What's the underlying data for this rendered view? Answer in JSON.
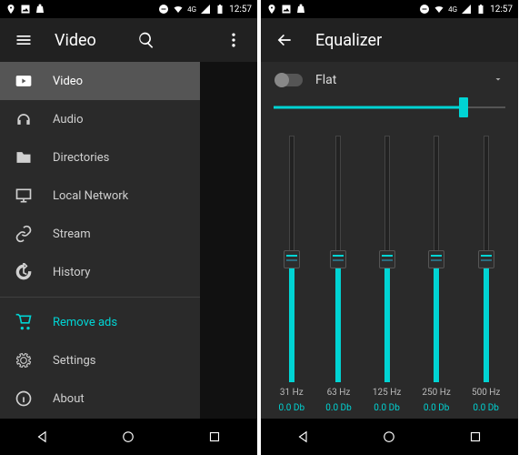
{
  "status": {
    "time": "12:57",
    "network": "4G"
  },
  "colors": {
    "accent": "#00d4d4"
  },
  "left": {
    "title": "Video",
    "drawer": {
      "items": [
        {
          "label": "Video",
          "icon": "play-rect-icon",
          "active": true
        },
        {
          "label": "Audio",
          "icon": "headphones-icon"
        },
        {
          "label": "Directories",
          "icon": "folder-icon"
        },
        {
          "label": "Local Network",
          "icon": "monitor-icon"
        },
        {
          "label": "Stream",
          "icon": "link-icon"
        },
        {
          "label": "History",
          "icon": "history-icon"
        }
      ],
      "items2": [
        {
          "label": "Remove ads",
          "icon": "cart-icon",
          "accent": true
        },
        {
          "label": "Settings",
          "icon": "gear-icon"
        },
        {
          "label": "About",
          "icon": "info-icon"
        }
      ]
    }
  },
  "right": {
    "title": "Equalizer",
    "toggle_on": false,
    "preset": "Flat",
    "preamp_percent": 82,
    "bands": [
      {
        "freq": "31 Hz",
        "db": "0.0 Db"
      },
      {
        "freq": "63 Hz",
        "db": "0.0 Db"
      },
      {
        "freq": "125 Hz",
        "db": "0.0 Db"
      },
      {
        "freq": "250 Hz",
        "db": "0.0 Db"
      },
      {
        "freq": "500 Hz",
        "db": "0.0 Db"
      }
    ]
  }
}
